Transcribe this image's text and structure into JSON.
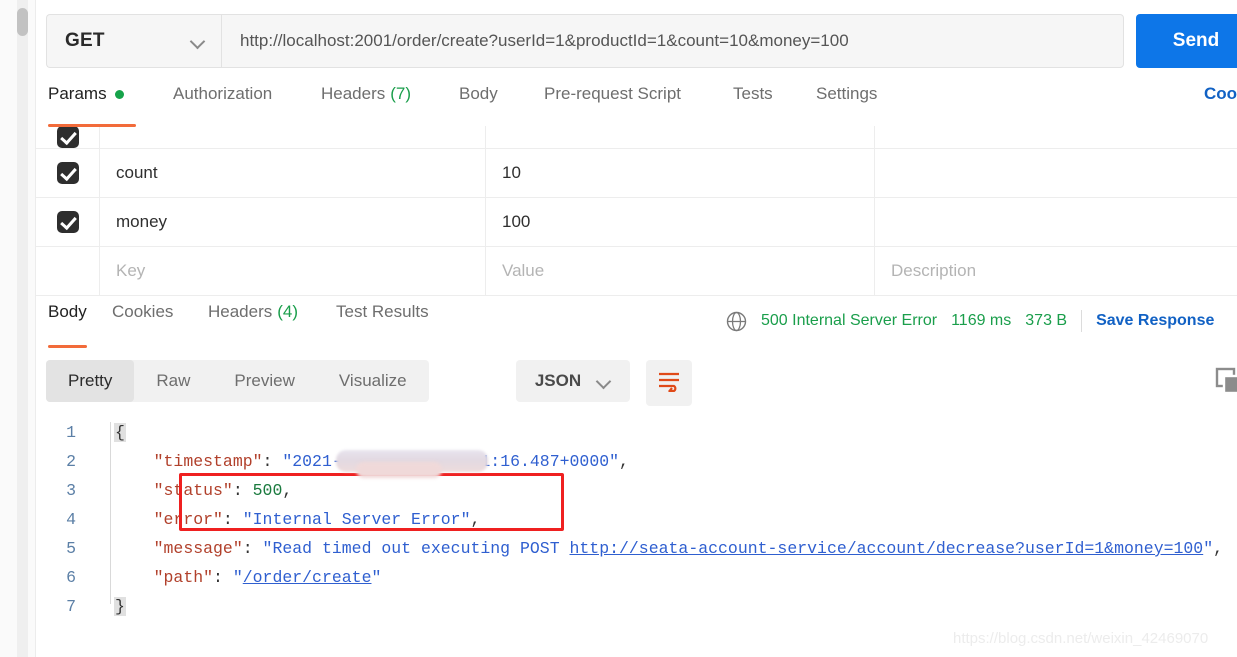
{
  "request": {
    "method": "GET",
    "url": "http://localhost:2001/order/create?userId=1&productId=1&count=10&money=100",
    "send_label": "Send",
    "tabs": [
      {
        "label": "Params",
        "badge": "",
        "dot": true,
        "active": true
      },
      {
        "label": "Authorization",
        "badge": "",
        "dot": false,
        "active": false
      },
      {
        "label": "Headers",
        "badge": "(7)",
        "dot": false,
        "active": false
      },
      {
        "label": "Body",
        "badge": "",
        "dot": false,
        "active": false
      },
      {
        "label": "Pre-request Script",
        "badge": "",
        "dot": false,
        "active": false
      },
      {
        "label": "Tests",
        "badge": "",
        "dot": false,
        "active": false
      },
      {
        "label": "Settings",
        "badge": "",
        "dot": false,
        "active": false
      }
    ],
    "cookies_link": "Coo"
  },
  "params_table": {
    "columns": [
      "Key",
      "Value",
      "Description"
    ],
    "rows": [
      {
        "checked": true,
        "key": "count",
        "value": "10",
        "description": ""
      },
      {
        "checked": true,
        "key": "money",
        "value": "100",
        "description": ""
      }
    ],
    "placeholder_row": {
      "key": "Key",
      "value": "Value",
      "description": "Description"
    }
  },
  "response": {
    "tabs": [
      {
        "label": "Body",
        "badge": "",
        "active": true
      },
      {
        "label": "Cookies",
        "badge": "",
        "active": false
      },
      {
        "label": "Headers",
        "badge": "(4)",
        "active": false
      },
      {
        "label": "Test Results",
        "badge": "",
        "active": false
      }
    ],
    "status": "500 Internal Server Error",
    "time": "1169 ms",
    "size": "373 B",
    "save_response": "Save Response",
    "view_modes": [
      {
        "label": "Pretty",
        "active": true
      },
      {
        "label": "Raw",
        "active": false
      },
      {
        "label": "Preview",
        "active": false
      },
      {
        "label": "Visualize",
        "active": false
      }
    ],
    "format": "JSON",
    "body_lines": [
      {
        "n": "1",
        "segments": [
          {
            "t": "{",
            "c": "brace"
          }
        ]
      },
      {
        "n": "2",
        "segments": [
          {
            "t": "    ",
            "c": "p"
          },
          {
            "t": "\"timestamp\"",
            "c": "k"
          },
          {
            "t": ": ",
            "c": "p"
          },
          {
            "t": "\"2021-",
            "c": "s"
          },
          {
            "t": "            ",
            "c": "s"
          },
          {
            "t": ".41:16.487+0000\"",
            "c": "s"
          },
          {
            "t": ",",
            "c": "p"
          }
        ]
      },
      {
        "n": "3",
        "segments": [
          {
            "t": "    ",
            "c": "p"
          },
          {
            "t": "\"status\"",
            "c": "k"
          },
          {
            "t": ": ",
            "c": "p"
          },
          {
            "t": "500",
            "c": "n"
          },
          {
            "t": ",",
            "c": "p"
          }
        ]
      },
      {
        "n": "4",
        "segments": [
          {
            "t": "    ",
            "c": "p"
          },
          {
            "t": "\"error\"",
            "c": "k"
          },
          {
            "t": ": ",
            "c": "p"
          },
          {
            "t": "\"Internal Server Error\"",
            "c": "s"
          },
          {
            "t": ",",
            "c": "p"
          }
        ]
      },
      {
        "n": "5",
        "segments": [
          {
            "t": "    ",
            "c": "p"
          },
          {
            "t": "\"message\"",
            "c": "k"
          },
          {
            "t": ": ",
            "c": "p"
          },
          {
            "t": "\"Read timed out executing POST ",
            "c": "s"
          },
          {
            "t": "http://seata-account-service/account/decrease?userId=1&money=100",
            "c": "lnk"
          },
          {
            "t": "\"",
            "c": "s"
          },
          {
            "t": ",",
            "c": "p"
          }
        ]
      },
      {
        "n": "6",
        "segments": [
          {
            "t": "    ",
            "c": "p"
          },
          {
            "t": "\"path\"",
            "c": "k"
          },
          {
            "t": ": ",
            "c": "p"
          },
          {
            "t": "\"",
            "c": "s"
          },
          {
            "t": "/order/create",
            "c": "lnk"
          },
          {
            "t": "\"",
            "c": "s"
          }
        ]
      },
      {
        "n": "7",
        "segments": [
          {
            "t": "}",
            "c": "brace"
          }
        ]
      }
    ]
  },
  "watermark": "https://blog.csdn.net/weixin_42469070"
}
